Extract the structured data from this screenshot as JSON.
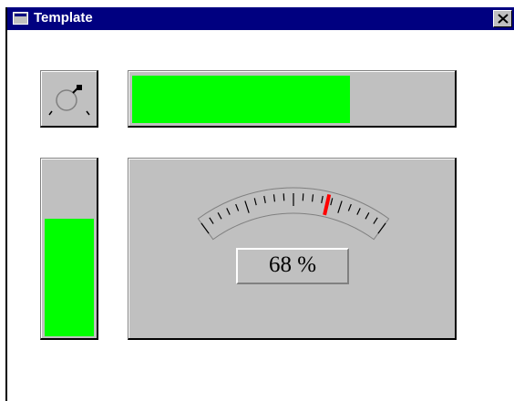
{
  "window": {
    "title": "Template"
  },
  "icons": {
    "app": "window-icon",
    "close": "close-icon",
    "knob": "knob-icon"
  },
  "colors": {
    "title_bar": "#000080",
    "title_text": "#ffffff",
    "face": "#c0c0c0",
    "fill": "#00ff00",
    "needle": "#ff0000"
  },
  "horizontal_bar": {
    "value": 68
  },
  "vertical_bar": {
    "value": 68
  },
  "gauge": {
    "value": 68,
    "min": 0,
    "max": 100,
    "ticks": 20,
    "readout": "68 %"
  }
}
